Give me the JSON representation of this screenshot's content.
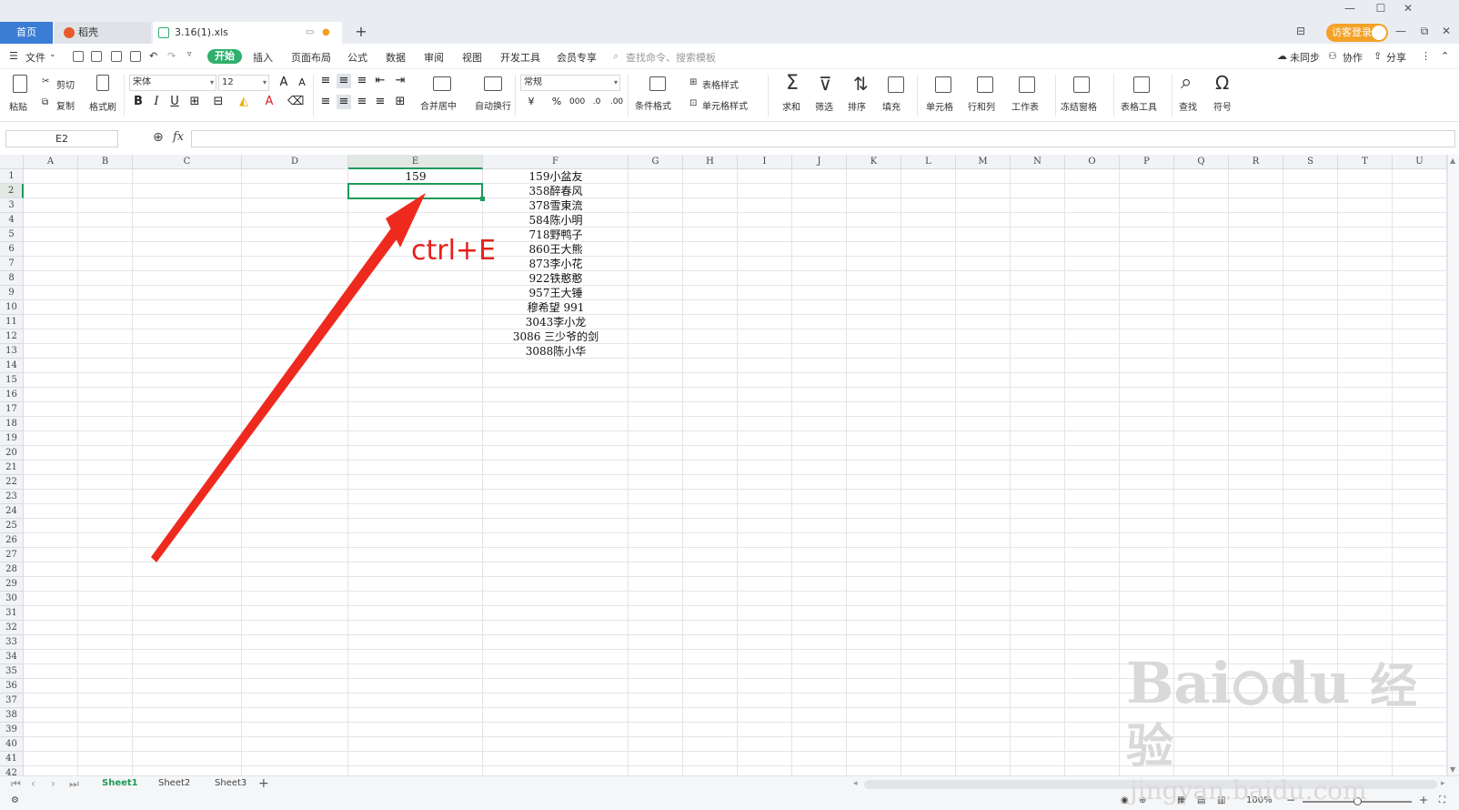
{
  "tabs": {
    "home": "首页",
    "daoke": "稻壳",
    "file": "3.16(1).xls",
    "new_tab": "+"
  },
  "window": {
    "login": "访客登录"
  },
  "menu": {
    "file": "文件",
    "start": "开始",
    "insert": "插入",
    "page_layout": "页面布局",
    "formula": "公式",
    "data": "数据",
    "review": "审阅",
    "view": "视图",
    "dev_tools": "开发工具",
    "member": "会员专享",
    "search_placeholder": "查找命令、搜索模板",
    "unsync": "未同步",
    "collab": "协作",
    "share": "分享"
  },
  "ribbon": {
    "paste": "粘贴",
    "cut": "剪切",
    "copy": "复制",
    "format_painter": "格式刷",
    "font_name": "宋体",
    "font_size": "12",
    "merge_center": "合并居中",
    "wrap_text": "自动换行",
    "number_format": "常规",
    "cond_format": "条件格式",
    "table_style": "表格样式",
    "cell_style": "单元格样式",
    "sum": "求和",
    "filter": "筛选",
    "sort": "排序",
    "fill": "填充",
    "cell": "单元格",
    "row_col": "行和列",
    "worksheet": "工作表",
    "freeze": "冻结窗格",
    "table_tools": "表格工具",
    "find": "查找",
    "symbol": "符号"
  },
  "formula_bar": {
    "name_box": "E2",
    "fx": "fx",
    "content": ""
  },
  "columns": [
    "A",
    "B",
    "C",
    "D",
    "E",
    "F",
    "G",
    "H",
    "I",
    "J",
    "K",
    "L",
    "M",
    "N",
    "O",
    "P",
    "Q",
    "R",
    "S",
    "T",
    "U"
  ],
  "rows": [
    "1",
    "2",
    "3",
    "4",
    "5",
    "6",
    "7",
    "8",
    "9",
    "10",
    "11",
    "12",
    "13",
    "14",
    "15",
    "16",
    "17",
    "18",
    "19",
    "20",
    "21",
    "22",
    "23",
    "24",
    "25",
    "26",
    "27",
    "28",
    "29",
    "30",
    "31",
    "32",
    "33",
    "34",
    "35",
    "36",
    "37",
    "38",
    "39",
    "40",
    "41",
    "42"
  ],
  "cells": {
    "E1": "159",
    "F": [
      "159小盆友",
      "358醉春风",
      "378雪東流",
      "584陈小明",
      "718野鸭子",
      "860王大熊",
      "873李小花",
      "922铁憨憨",
      "957王大锤",
      "穆希望 991",
      "3043李小龙",
      "3086 三少爷的剑",
      "3088陈小华"
    ]
  },
  "selected_cell": "E2",
  "annotation": {
    "label": "ctrl+E",
    "color": "#e4201b"
  },
  "sheets": [
    "Sheet1",
    "Sheet2",
    "Sheet3"
  ],
  "active_sheet": "Sheet1",
  "status": {
    "zoom": "100%",
    "zoom_level": 0.5
  },
  "watermark": {
    "brand": "Bai",
    "brand2": "du",
    "cn": "经验",
    "url": "jingyan.baidu.com"
  },
  "colors": {
    "accent_green": "#2fb06c",
    "home_tab": "#3b7cd4",
    "login": "#f3a228"
  }
}
